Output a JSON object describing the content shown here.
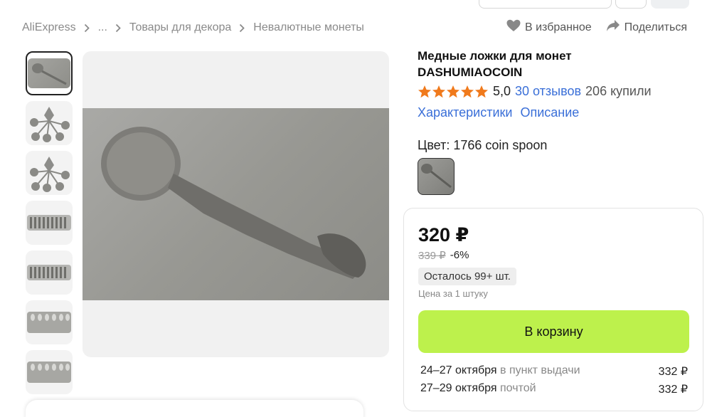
{
  "breadcrumb": {
    "items": [
      "AliExpress",
      "...",
      "Товары для декора",
      "Невалютные монеты"
    ]
  },
  "actions": {
    "favorite_label": "В избранное",
    "share_label": "Поделиться"
  },
  "product": {
    "title": "Медные ложки для монет DASHUMIAOCOIN",
    "rating": "5,0",
    "reviews": "30 отзывов",
    "bought": "206 купили",
    "rating_stars": 5,
    "tabs": [
      "Характеристики",
      "Описание"
    ],
    "color_label": "Цвет: 1766 coin spoon"
  },
  "buy": {
    "price": "320 ₽",
    "old_price": "339 ₽",
    "discount": "-6%",
    "stock": "Осталось 99+ шт.",
    "unit_note": "Цена за 1 штуку",
    "cart_button": "В корзину",
    "delivery": [
      {
        "date": "24–27 октября",
        "method": "в пункт выдачи",
        "price": "332 ₽"
      },
      {
        "date": "27–29 октября",
        "method": "почтой",
        "price": "332 ₽"
      }
    ]
  },
  "colors": {
    "link": "#3a6fd8",
    "star": "#f07a1c",
    "cart": "#bdf14c"
  }
}
